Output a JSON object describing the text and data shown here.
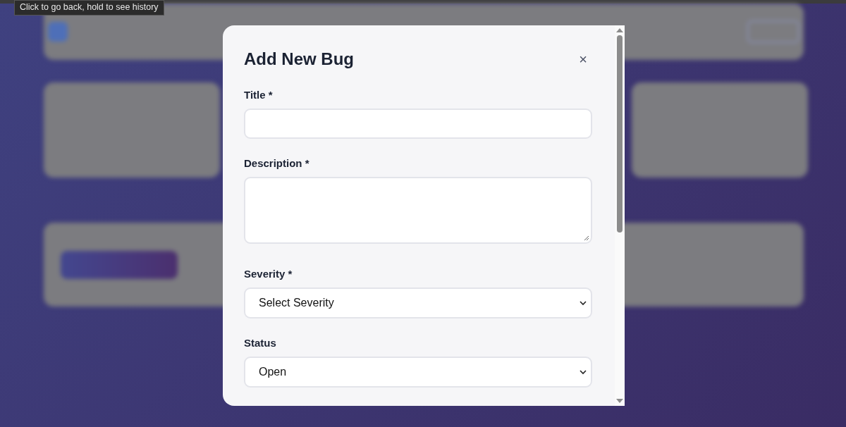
{
  "tooltip": {
    "text": "Click to go back, hold to see history"
  },
  "modal": {
    "title": "Add New Bug",
    "close": "×",
    "fields": [
      {
        "kind": "text",
        "label": "Title *"
      },
      {
        "kind": "textarea",
        "label": "Description *"
      },
      {
        "kind": "select",
        "label": "Severity *",
        "value": "Select Severity"
      },
      {
        "kind": "select",
        "label": "Status",
        "value": "Open"
      }
    ]
  }
}
